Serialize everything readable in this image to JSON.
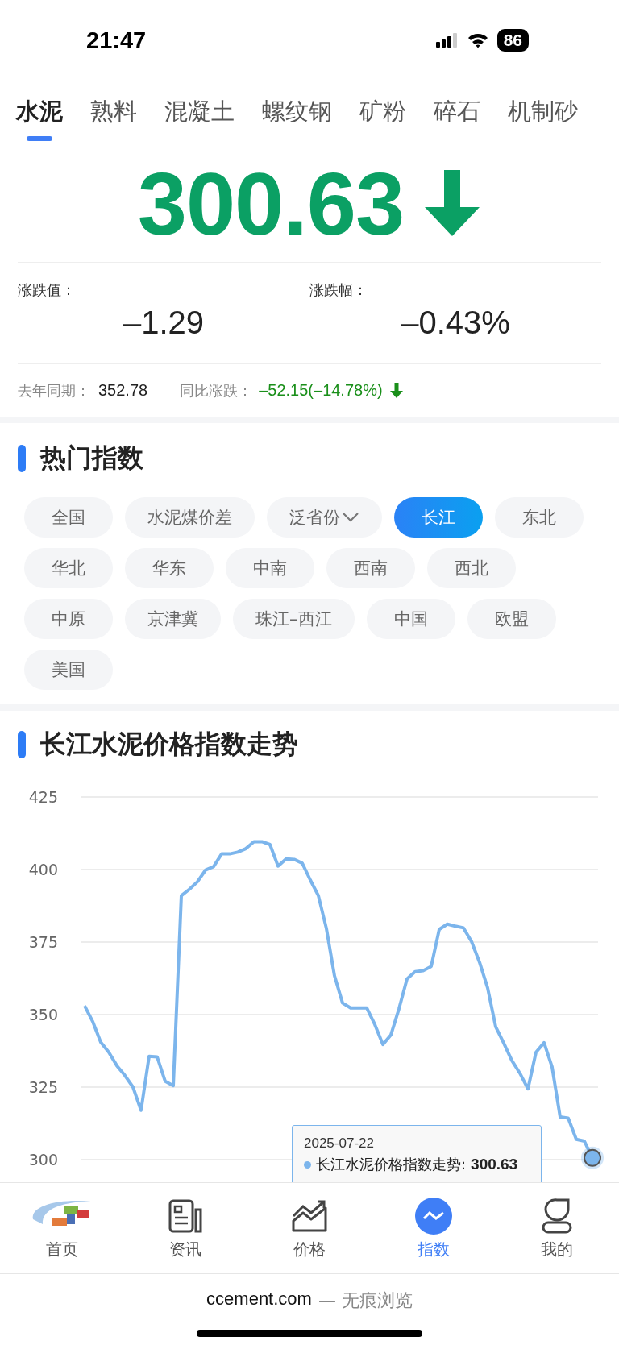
{
  "status_bar": {
    "time": "21:47",
    "battery": "86"
  },
  "tabs": [
    {
      "label": "水泥",
      "selected": true
    },
    {
      "label": "熟料",
      "selected": false
    },
    {
      "label": "混凝土",
      "selected": false
    },
    {
      "label": "螺纹钢",
      "selected": false
    },
    {
      "label": "矿粉",
      "selected": false
    },
    {
      "label": "碎石",
      "selected": false
    },
    {
      "label": "机制砂",
      "selected": false
    }
  ],
  "price": {
    "value": "300.63",
    "falling": true
  },
  "changes": [
    {
      "label": "涨跌值：",
      "value": "–1.29"
    },
    {
      "label": "涨跌幅：",
      "value": "–0.43%"
    }
  ],
  "yoy": {
    "label": "去年同期：",
    "value": "352.78",
    "change_label": "同比涨跌：",
    "change_value": "–52.15(–14.78%)",
    "falling": true
  },
  "hot": {
    "title": "热门指数",
    "chips": [
      {
        "label": "全国",
        "selected": false,
        "kind": "plain"
      },
      {
        "label": "水泥煤价差",
        "selected": false,
        "kind": "plain"
      },
      {
        "label": "泛省份",
        "selected": false,
        "kind": "dropdown"
      },
      {
        "label": "长江",
        "selected": true,
        "kind": "plain"
      },
      {
        "label": "东北",
        "selected": false,
        "kind": "plain"
      },
      {
        "label": "华北",
        "selected": false,
        "kind": "plain"
      },
      {
        "label": "华东",
        "selected": false,
        "kind": "plain"
      },
      {
        "label": "中南",
        "selected": false,
        "kind": "plain"
      },
      {
        "label": "西南",
        "selected": false,
        "kind": "plain"
      },
      {
        "label": "西北",
        "selected": false,
        "kind": "plain"
      },
      {
        "label": "中原",
        "selected": false,
        "kind": "plain"
      },
      {
        "label": "京津冀",
        "selected": false,
        "kind": "plain"
      },
      {
        "label": "珠江–西江",
        "selected": false,
        "kind": "plain"
      },
      {
        "label": "中国",
        "selected": false,
        "kind": "plain"
      },
      {
        "label": "欧盟",
        "selected": false,
        "kind": "plain"
      },
      {
        "label": "美国",
        "selected": false,
        "kind": "plain"
      }
    ]
  },
  "trend": {
    "title": "长江水泥价格指数走势",
    "chart_data": {
      "type": "line",
      "grid": true,
      "ylim": [
        300,
        425
      ],
      "yticks": [
        300,
        325,
        350,
        375,
        400,
        425
      ],
      "categories": [
        null,
        null,
        null,
        null,
        null,
        null,
        null,
        null,
        null,
        null,
        null,
        null,
        null,
        null,
        null,
        null,
        null,
        null,
        null,
        null,
        null,
        null,
        null,
        null,
        null,
        null,
        null,
        null,
        null,
        null,
        null,
        null,
        null,
        null,
        null,
        null,
        null,
        null,
        null,
        null,
        null,
        null,
        null,
        null,
        null,
        null,
        null,
        null,
        null,
        null,
        null,
        null,
        null,
        null,
        null,
        null,
        null,
        null,
        null,
        null,
        null,
        null,
        null,
        null
      ],
      "series": [
        {
          "color": "#7cb5ec",
          "values": [
            353,
            347.6,
            340.5,
            337,
            332.4,
            329,
            325,
            317,
            335.6,
            335.4,
            327,
            325.5,
            391,
            393.2,
            395.8,
            399.8,
            401,
            405.4,
            405.4,
            406,
            407.2,
            409.6,
            409.6,
            408.6,
            401.2,
            403.7,
            403.5,
            402.2,
            396.4,
            391,
            379.6,
            363.4,
            354,
            352.3,
            352.3,
            352.3,
            346.6,
            339.7,
            343,
            352,
            362.3,
            364.8,
            365.1,
            366.6,
            379.4,
            381.2,
            380.5,
            379.9,
            375.2,
            368,
            359.2,
            345.8,
            340.2,
            334.2,
            329.8,
            324.4,
            337,
            340.3,
            331.9,
            314.7,
            314.3,
            307,
            306.4,
            300.6
          ]
        }
      ]
    },
    "tooltip": {
      "date": "2025-07-22",
      "series": "长江水泥价格指数走势:",
      "value": "300.63"
    }
  },
  "nav": [
    {
      "label": "首页",
      "selected": false
    },
    {
      "label": "资讯",
      "selected": false
    },
    {
      "label": "价格",
      "selected": false
    },
    {
      "label": "指数",
      "selected": true
    },
    {
      "label": "我的",
      "selected": false
    }
  ],
  "browser": {
    "domain": "ccement.com",
    "mode": "— 无痕浏览"
  }
}
